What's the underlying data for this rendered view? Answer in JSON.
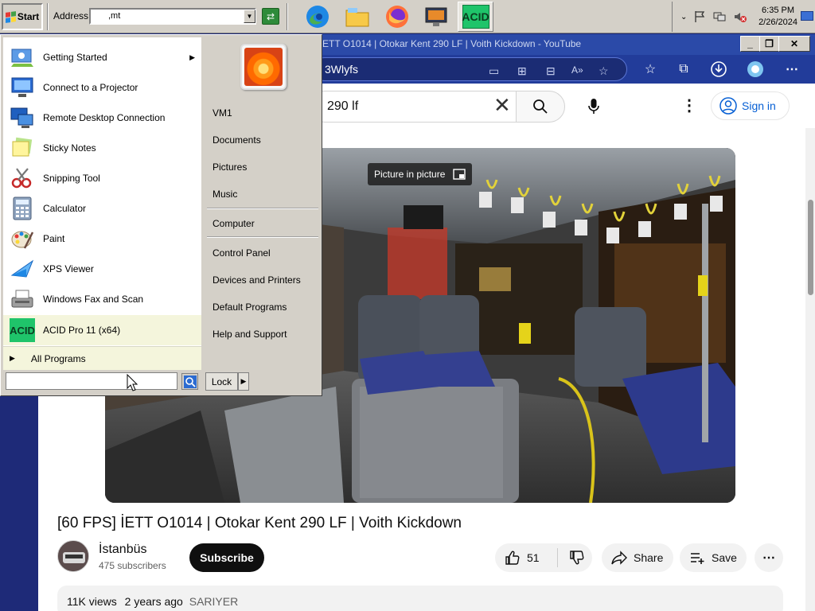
{
  "taskbar": {
    "start_label": "Start",
    "address_label": "Address",
    "address_value": ",mt",
    "apps": [
      {
        "name": "edge-app"
      },
      {
        "name": "file-explorer-app"
      },
      {
        "name": "firefox-app"
      },
      {
        "name": "media-app"
      },
      {
        "name": "acid-app",
        "label": "ACID"
      }
    ],
    "clock_time": "6:35 PM",
    "clock_date": "2/26/2024"
  },
  "browser": {
    "window_title": "ETT O1014 | Otokar Kent 290 LF | Voith Kickdown - YouTube",
    "url_text": "3Wlyfs"
  },
  "youtube": {
    "search_value": "290 lf",
    "signin_label": "Sign in",
    "pip_label": "Picture in picture",
    "video_title": "[60 FPS] İETT O1014 | Otokar Kent 290 LF | Voith Kickdown",
    "channel_name": "İstanbüs",
    "channel_subs": "475 subscribers",
    "subscribe_label": "Subscribe",
    "like_count": "51",
    "share_label": "Share",
    "save_label": "Save",
    "views": "11K views",
    "age": "2 years ago",
    "location": "SARIYER"
  },
  "start_menu": {
    "programs": [
      {
        "label": "Getting Started",
        "icon": "getting-started-icon",
        "submenu": true
      },
      {
        "label": "Connect to a Projector",
        "icon": "projector-icon"
      },
      {
        "label": "Remote Desktop Connection",
        "icon": "remote-desktop-icon"
      },
      {
        "label": "Sticky Notes",
        "icon": "sticky-notes-icon"
      },
      {
        "label": "Snipping Tool",
        "icon": "snipping-tool-icon"
      },
      {
        "label": "Calculator",
        "icon": "calculator-icon"
      },
      {
        "label": "Paint",
        "icon": "paint-icon"
      },
      {
        "label": "XPS Viewer",
        "icon": "xps-viewer-icon"
      },
      {
        "label": "Windows Fax and Scan",
        "icon": "fax-scan-icon"
      },
      {
        "label": "ACID Pro 11 (x64)",
        "icon": "acid-pro-icon",
        "highlight": true
      }
    ],
    "all_programs": "All Programs",
    "right_links": {
      "user": "VM1",
      "documents": "Documents",
      "pictures": "Pictures",
      "music": "Music",
      "computer": "Computer",
      "control_panel": "Control Panel",
      "devices": "Devices and Printers",
      "default_programs": "Default Programs",
      "help": "Help and Support"
    },
    "lock_label": "Lock",
    "search_value": ""
  }
}
